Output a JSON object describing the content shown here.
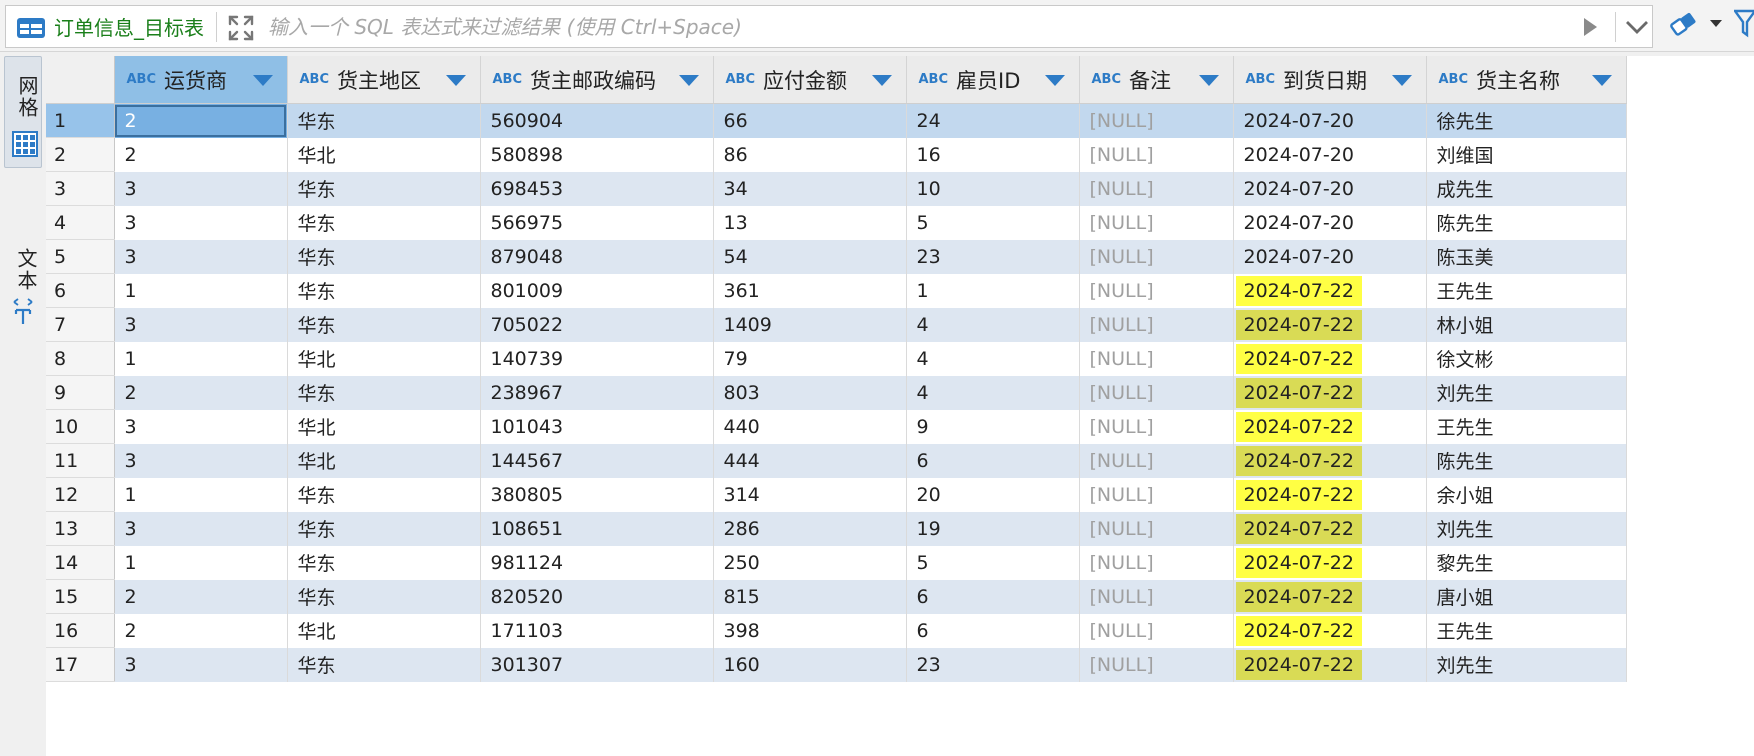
{
  "toolbar": {
    "table_name": "订单信息_目标表",
    "filter_placeholder": "输入一个 SQL 表达式来过滤结果 (使用 Ctrl+Space)",
    "filter_value": ""
  },
  "side_tabs": {
    "grid": "网格",
    "text": "文本"
  },
  "type_tag": "ABC",
  "columns": [
    "运货商",
    "货主地区",
    "货主邮政编码",
    "应付金额",
    "雇员ID",
    "备注",
    "到货日期",
    "货主名称"
  ],
  "rows": [
    {
      "n": "1",
      "c": [
        "2",
        "华东",
        "560904",
        "66",
        "24",
        "[NULL]",
        "2024-07-20",
        "徐先生"
      ]
    },
    {
      "n": "2",
      "c": [
        "2",
        "华北",
        "580898",
        "86",
        "16",
        "[NULL]",
        "2024-07-20",
        "刘维国"
      ]
    },
    {
      "n": "3",
      "c": [
        "3",
        "华东",
        "698453",
        "34",
        "10",
        "[NULL]",
        "2024-07-20",
        "成先生"
      ]
    },
    {
      "n": "4",
      "c": [
        "3",
        "华东",
        "566975",
        "13",
        "5",
        "[NULL]",
        "2024-07-20",
        "陈先生"
      ]
    },
    {
      "n": "5",
      "c": [
        "3",
        "华东",
        "879048",
        "54",
        "23",
        "[NULL]",
        "2024-07-20",
        "陈玉美"
      ]
    },
    {
      "n": "6",
      "c": [
        "1",
        "华东",
        "801009",
        "361",
        "1",
        "[NULL]",
        "2024-07-22",
        "王先生"
      ]
    },
    {
      "n": "7",
      "c": [
        "3",
        "华东",
        "705022",
        "1409",
        "4",
        "[NULL]",
        "2024-07-22",
        "林小姐"
      ]
    },
    {
      "n": "8",
      "c": [
        "1",
        "华北",
        "140739",
        "79",
        "4",
        "[NULL]",
        "2024-07-22",
        "徐文彬"
      ]
    },
    {
      "n": "9",
      "c": [
        "2",
        "华东",
        "238967",
        "803",
        "4",
        "[NULL]",
        "2024-07-22",
        "刘先生"
      ]
    },
    {
      "n": "10",
      "c": [
        "3",
        "华北",
        "101043",
        "440",
        "9",
        "[NULL]",
        "2024-07-22",
        "王先生"
      ]
    },
    {
      "n": "11",
      "c": [
        "3",
        "华北",
        "144567",
        "444",
        "6",
        "[NULL]",
        "2024-07-22",
        "陈先生"
      ]
    },
    {
      "n": "12",
      "c": [
        "1",
        "华东",
        "380805",
        "314",
        "20",
        "[NULL]",
        "2024-07-22",
        "余小姐"
      ]
    },
    {
      "n": "13",
      "c": [
        "3",
        "华东",
        "108651",
        "286",
        "19",
        "[NULL]",
        "2024-07-22",
        "刘先生"
      ]
    },
    {
      "n": "14",
      "c": [
        "1",
        "华东",
        "981124",
        "250",
        "5",
        "[NULL]",
        "2024-07-22",
        "黎先生"
      ]
    },
    {
      "n": "15",
      "c": [
        "2",
        "华东",
        "820520",
        "815",
        "6",
        "[NULL]",
        "2024-07-22",
        "唐小姐"
      ]
    },
    {
      "n": "16",
      "c": [
        "2",
        "华北",
        "171103",
        "398",
        "6",
        "[NULL]",
        "2024-07-22",
        "王先生"
      ]
    },
    {
      "n": "17",
      "c": [
        "3",
        "华东",
        "301307",
        "160",
        "23",
        "[NULL]",
        "2024-07-22",
        "刘先生"
      ]
    }
  ],
  "highlight_value": "2024-07-22",
  "colors": {
    "highlight": "#ffff44",
    "selected_header": "#8fbfe6",
    "alt_row": "#dde6f1",
    "table_name": "#1a7f1a",
    "type_tag": "#2d7bc6"
  },
  "icons": [
    "table-icon",
    "expand-icon",
    "run-icon",
    "history-dropdown-icon",
    "eraser-icon",
    "filter-funnel-icon",
    "grid-view-icon",
    "text-view-icon",
    "sort-dropdown-icon"
  ]
}
